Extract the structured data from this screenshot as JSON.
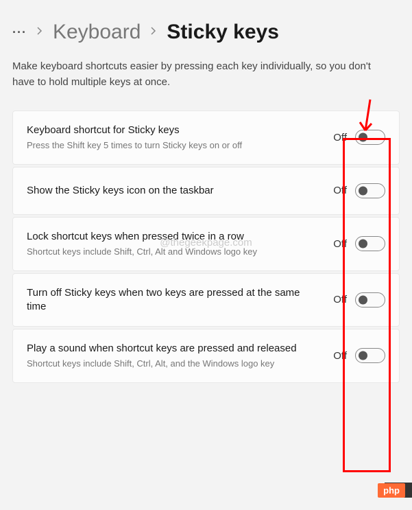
{
  "breadcrumb": {
    "dots": "···",
    "parent": "Keyboard",
    "current": "Sticky keys"
  },
  "description": "Make keyboard shortcuts easier by pressing each key individually, so you don't have to hold multiple keys at once.",
  "settings": [
    {
      "title": "Keyboard shortcut for Sticky keys",
      "subtitle": "Press the Shift key 5 times to turn Sticky keys on or off",
      "state_label": "Off"
    },
    {
      "title": "Show the Sticky keys icon on the taskbar",
      "subtitle": "",
      "state_label": "Off"
    },
    {
      "title": "Lock shortcut keys when pressed twice in a row",
      "subtitle": "Shortcut keys include Shift, Ctrl, Alt and Windows logo key",
      "state_label": "Off"
    },
    {
      "title": "Turn off Sticky keys when two keys are pressed at the same time",
      "subtitle": "",
      "state_label": "Off"
    },
    {
      "title": "Play a sound when shortcut keys are pressed and released",
      "subtitle": "Shortcut keys include Shift, Ctrl, Alt, and the Windows logo key",
      "state_label": "Off"
    }
  ],
  "watermark": "@thegeekpage.com",
  "badge": "php"
}
